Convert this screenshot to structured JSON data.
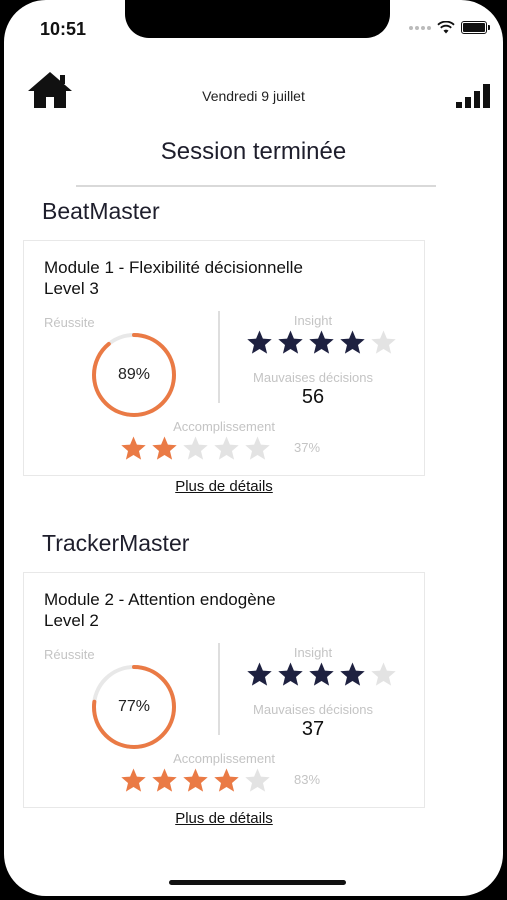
{
  "status_bar": {
    "time": "10:51"
  },
  "header": {
    "date": "Vendredi 9 juillet",
    "title": "Session terminée"
  },
  "colors": {
    "navy": "#1e2140",
    "orange": "#ea7a45",
    "gray_star": "#e3e3e3",
    "label": "#c4c4c4"
  },
  "sessions": [
    {
      "name": "BeatMaster",
      "module": "Module 1 - Flexibilité décisionnelle",
      "level": "Level 3",
      "reussite_label": "Réussite",
      "reussite_value": "89%",
      "reussite_fraction": 0.89,
      "insight_label": "Insight",
      "insight_stars": 4,
      "mauvaises_label": "Mauvaises décisions",
      "mauvaises_value": "56",
      "accomplissement_label": "Accomplissement",
      "accomplissement_stars": 2,
      "accomplissement_pct": "37%",
      "details_label": "Plus de détails"
    },
    {
      "name": "TrackerMaster",
      "module": "Module 2 - Attention endogène",
      "level": "Level 2",
      "reussite_label": "Réussite",
      "reussite_value": "77%",
      "reussite_fraction": 0.77,
      "insight_label": "Insight",
      "insight_stars": 4,
      "mauvaises_label": "Mauvaises décisions",
      "mauvaises_value": "37",
      "accomplissement_label": "Accomplissement",
      "accomplissement_stars": 4,
      "accomplissement_pct": "83%",
      "details_label": "Plus de détails"
    }
  ]
}
